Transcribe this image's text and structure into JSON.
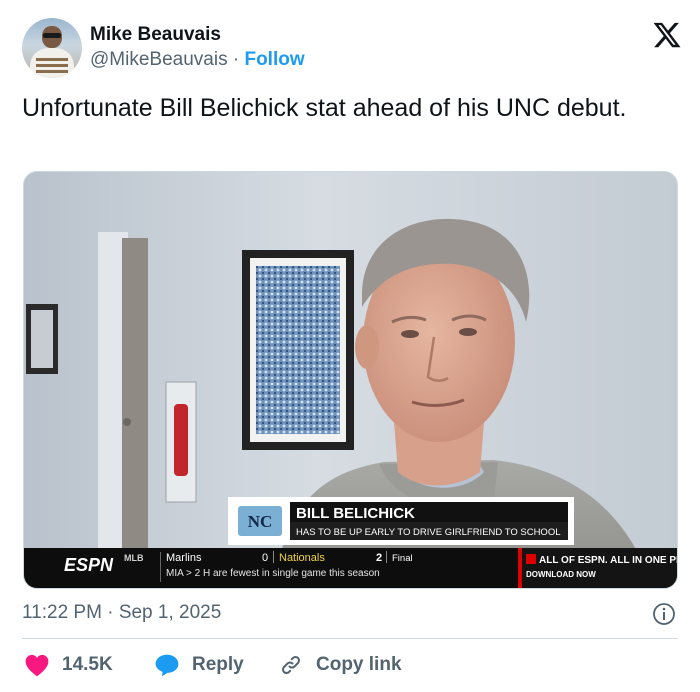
{
  "author": {
    "name": "Mike Beauvais",
    "handle": "@MikeBeauvais",
    "separator": "·",
    "follow_label": "Follow"
  },
  "tweet": {
    "text": "Unfortunate Bill Belichick stat ahead of his UNC debut."
  },
  "media": {
    "lower_third": {
      "name": "BILL BELICHICK",
      "subtitle": "HAS TO BE UP EARLY TO DRIVE GIRLFRIEND TO SCHOOL"
    },
    "ticker": {
      "network": "ESPN",
      "league": "MLB",
      "away_team": "Marlins",
      "away_score": "0",
      "home_team": "Nationals",
      "home_score": "2",
      "status": "Final",
      "stat_line": "MIA  >  2 H are fewest in single game this season",
      "promo_title": "ALL OF ESPN. ALL IN ONE PLA",
      "promo_cta": "DOWNLOAD NOW"
    }
  },
  "meta": {
    "time": "11:22 PM",
    "separator": "·",
    "date": "Sep 1, 2025"
  },
  "actions": {
    "likes": "14.5K",
    "reply_label": "Reply",
    "copy_label": "Copy link"
  },
  "icons": {
    "x_logo": "x-logo-icon",
    "info": "info-icon",
    "like": "heart-icon",
    "reply": "reply-bubble-icon",
    "copy": "link-icon"
  },
  "colors": {
    "accent": "#1d9bf0",
    "like": "#f91880",
    "text_primary": "#0f1419",
    "text_secondary": "#536471"
  }
}
